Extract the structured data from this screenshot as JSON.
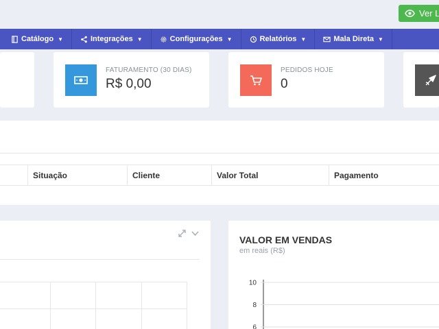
{
  "header": {
    "view_store_label": "Ver Loja"
  },
  "nav": [
    {
      "label": "Catálogo",
      "icon": "book-icon"
    },
    {
      "label": "Integrações",
      "icon": "share-icon"
    },
    {
      "label": "Configurações",
      "icon": "gear-icon"
    },
    {
      "label": "Relatórios",
      "icon": "clock-icon"
    },
    {
      "label": "Mala Direta",
      "icon": "envelope-icon"
    }
  ],
  "kpis": [
    {
      "label": "FATURAMENTO (30 DIAS)",
      "value": "R$ 0,00",
      "color": "#3598dc",
      "icon": "money-icon"
    },
    {
      "label": "PEDIDOS HOJE",
      "value": "0",
      "color": "#f36a5a",
      "icon": "cart-icon"
    },
    {
      "label": "",
      "value": "",
      "color": "#555555",
      "icon": "plane-icon"
    }
  ],
  "orders_table": {
    "columns": [
      "Situação",
      "Cliente",
      "Valor Total",
      "Pagamento"
    ]
  },
  "sales_chart": {
    "title": "VALOR EM VENDAS",
    "subtitle": "em reais (R$)"
  },
  "chart_data": {
    "type": "line",
    "title": "VALOR EM VENDAS",
    "subtitle": "em reais (R$)",
    "ylim": [
      6,
      10
    ],
    "yticks": [
      10,
      8,
      6
    ],
    "series": []
  }
}
